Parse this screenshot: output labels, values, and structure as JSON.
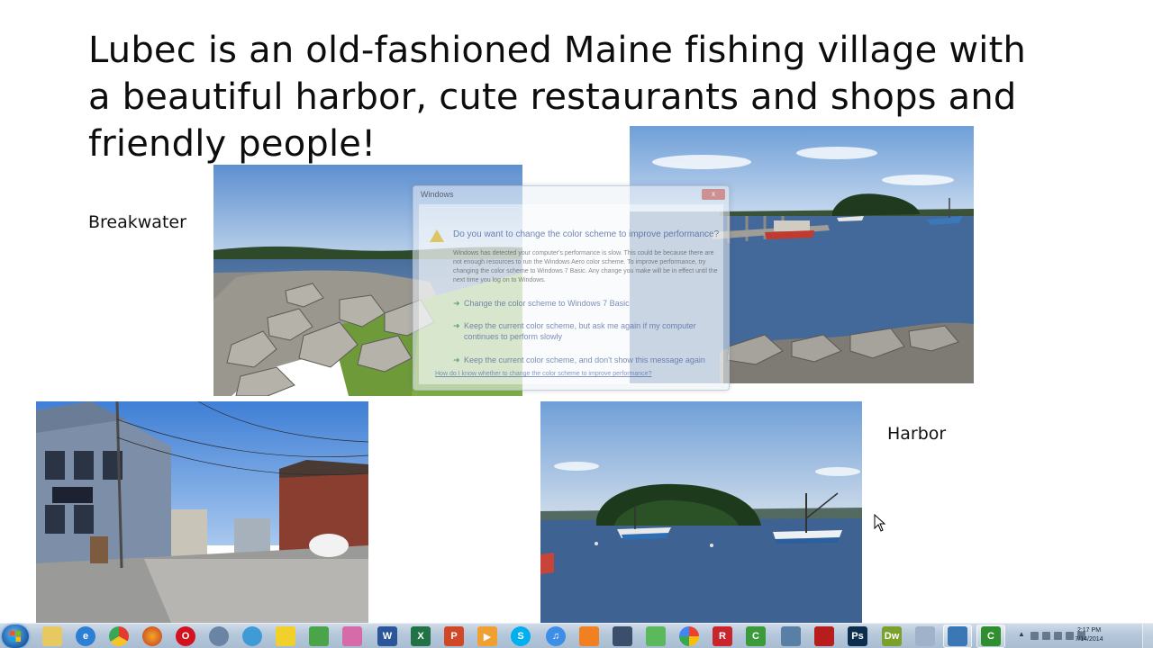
{
  "slide": {
    "title": "Lubec is an old-fashioned Maine fishing village with a beautiful harbor, cute restaurants and shops and friendly people!",
    "caption_left": "Breakwater",
    "caption_right": "Harbor"
  },
  "dialog": {
    "title": "Windows",
    "close_label": "x",
    "question": "Do you want to change the color scheme to improve performance?",
    "description": "Windows has detected your computer's performance is slow. This could be because there are not enough resources to run the Windows Aero color scheme. To improve performance, try changing the color scheme to Windows 7 Basic. Any change you make will be in effect until the next time you log on to Windows.",
    "option_1": "Change the color scheme to Windows 7 Basic",
    "option_2": "Keep the current color scheme, but ask me again if my computer continues to perform slowly",
    "option_3": "Keep the current color scheme, and don't show this message again",
    "help_link": "How do I know whether to change the color scheme to improve performance?"
  },
  "taskbar": {
    "clock_time": "2:17 PM",
    "clock_date": "7/14/2014",
    "pinned_icons": [
      "folder-icon",
      "internet-explorer-icon",
      "chrome-icon",
      "firefox-icon",
      "opera-icon",
      "settings-icon",
      "network-icon",
      "game-icon",
      "messenger-icon",
      "gift-icon",
      "word-icon",
      "excel-icon",
      "powerpoint-icon",
      "media-player-icon",
      "skype-icon",
      "itunes-icon",
      "vlc-icon",
      "calculator-device-icon",
      "sync-icon",
      "picasa-icon",
      "reader-icon",
      "camtasia-icon",
      "network-tool-icon",
      "acrobat-icon",
      "photoshop-icon",
      "dreamweaver-icon",
      "calculator-icon",
      "picture-viewer-icon",
      "camtasia-recorder-icon"
    ]
  },
  "colors": {
    "sky": "#7aa9dc",
    "water": "#43689a",
    "grass": "#6f9a3a",
    "taskbar": "#b5c7da"
  }
}
